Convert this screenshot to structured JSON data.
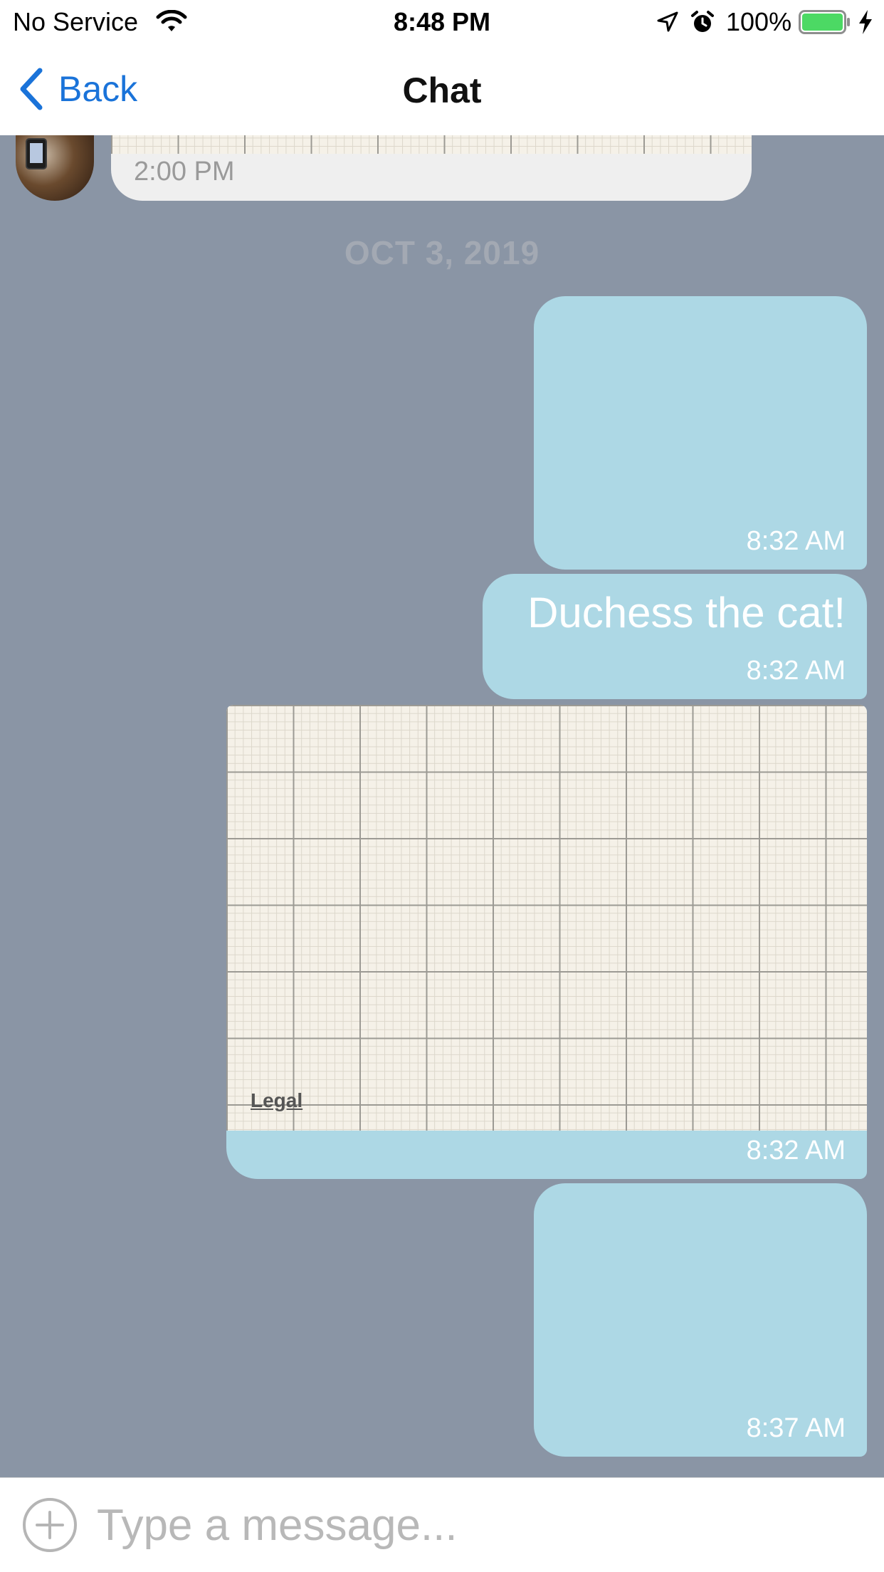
{
  "status_bar": {
    "carrier": "No Service",
    "time": "8:48 PM",
    "battery_percent": "100%",
    "battery_level": 1.0,
    "icons": [
      "wifi-icon",
      "location-icon",
      "alarm-icon",
      "battery-icon",
      "charging-icon"
    ]
  },
  "nav": {
    "back_label": "Back",
    "title": "Chat"
  },
  "chat": {
    "incoming": {
      "time": "2:00 PM",
      "attachment": "map"
    },
    "date_divider": "OCT 3, 2019",
    "outgoing": [
      {
        "type": "photo",
        "time": "8:32 AM"
      },
      {
        "type": "text",
        "text": "Duchess the cat!",
        "time": "8:32 AM"
      },
      {
        "type": "map",
        "legal": "Legal",
        "time": "8:32 AM"
      },
      {
        "type": "photo",
        "time": "8:37 AM"
      }
    ]
  },
  "input": {
    "placeholder": "Type a message..."
  },
  "colors": {
    "accent": "#1a73d9",
    "chat_background": "#8a95a5",
    "outgoing_bubble": "#add8e5",
    "incoming_bubble": "#efefef",
    "battery_fill": "#4cd964"
  }
}
